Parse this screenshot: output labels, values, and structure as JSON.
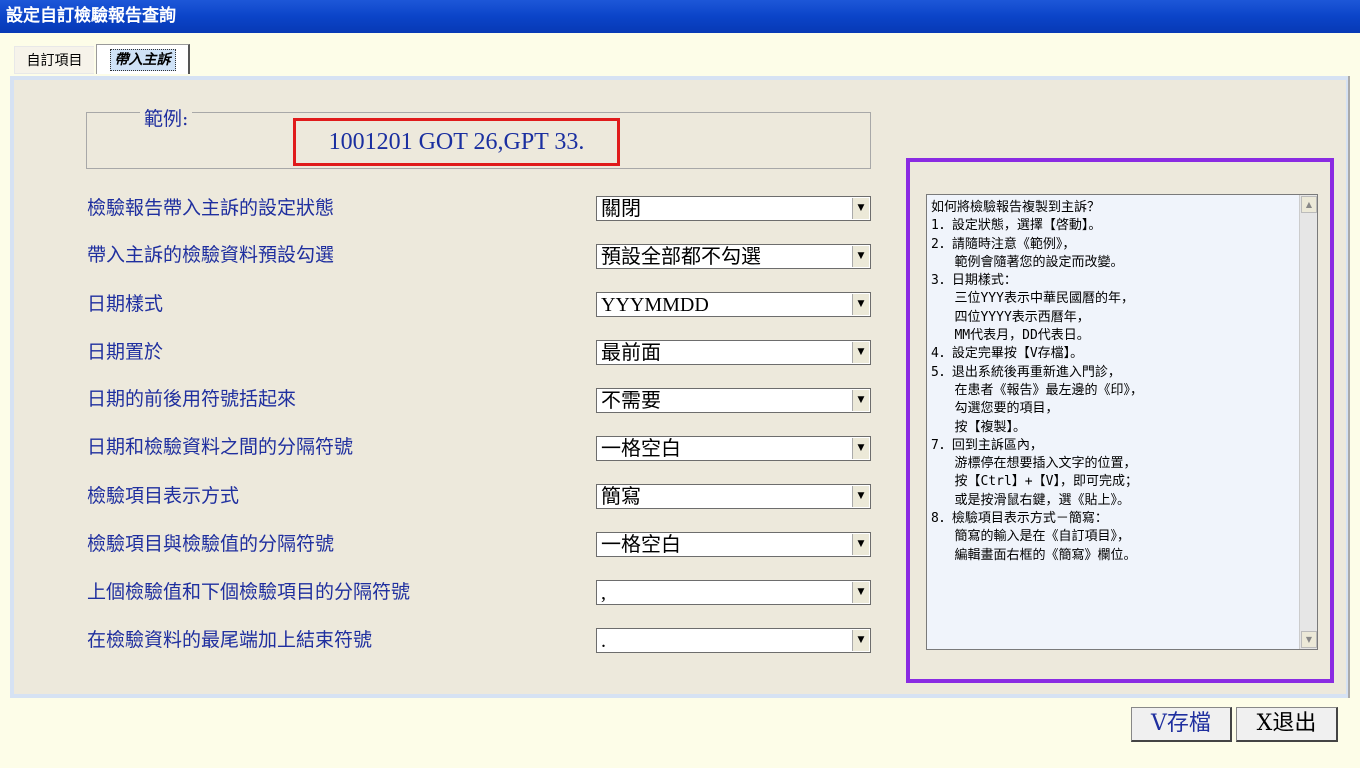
{
  "window": {
    "title": "設定自訂檢驗報告查詢"
  },
  "tabs": [
    {
      "label": "自訂項目"
    },
    {
      "label": "帶入主訴"
    }
  ],
  "example": {
    "label": "範例:",
    "value": "1001201 GOT 26,GPT 33."
  },
  "settings": [
    {
      "label": "檢驗報告帶入主訴的設定狀態",
      "value": "關閉"
    },
    {
      "label": "帶入主訴的檢驗資料預設勾選",
      "value": "預設全部都不勾選"
    },
    {
      "label": "日期樣式",
      "value": "YYYMMDD"
    },
    {
      "label": "日期置於",
      "value": "最前面"
    },
    {
      "label": "日期的前後用符號括起來",
      "value": "不需要"
    },
    {
      "label": "日期和檢驗資料之間的分隔符號",
      "value": "一格空白"
    },
    {
      "label": "檢驗項目表示方式",
      "value": "簡寫"
    },
    {
      "label": "檢驗項目與檢驗值的分隔符號",
      "value": "一格空白"
    },
    {
      "label": "上個檢驗值和下個檢驗項目的分隔符號",
      "value": ","
    },
    {
      "label": "在檢驗資料的最尾端加上結束符號",
      "value": "."
    }
  ],
  "help": {
    "text": "如何將檢驗報告複製到主訴？\n1．設定狀態，選擇【啓動】。\n2．請隨時注意《範例》，\n   範例會隨著您的設定而改變。\n3．日期樣式：\n   三位YYY表示中華民國曆的年，\n   四位YYYY表示西曆年，\n   MM代表月，DD代表日。\n4．設定完畢按【V存檔】。\n5．退出系統後再重新進入門診，\n   在患者《報告》最左邊的《印》，\n   勾選您要的項目，\n   按【複製】。\n7．回到主訴區內，\n   游標停在想要插入文字的位置，\n   按【Ctrl】+【V】，即可完成；\n   或是按滑鼠右鍵，選《貼上》。\n8．檢驗項目表示方式－簡寫：\n   簡寫的輸入是在《自訂項目》，\n   編輯畫面右框的《簡寫》欄位。"
  },
  "buttons": {
    "save": "V存檔",
    "exit": "X退出"
  },
  "colors": {
    "titlebar": "#0b44c8",
    "label_text": "#1f2f9f",
    "example_border": "#e01b1b",
    "help_border": "#8a2be2",
    "panel_bg": "#ede9dc",
    "window_bg": "#fdfde8"
  }
}
